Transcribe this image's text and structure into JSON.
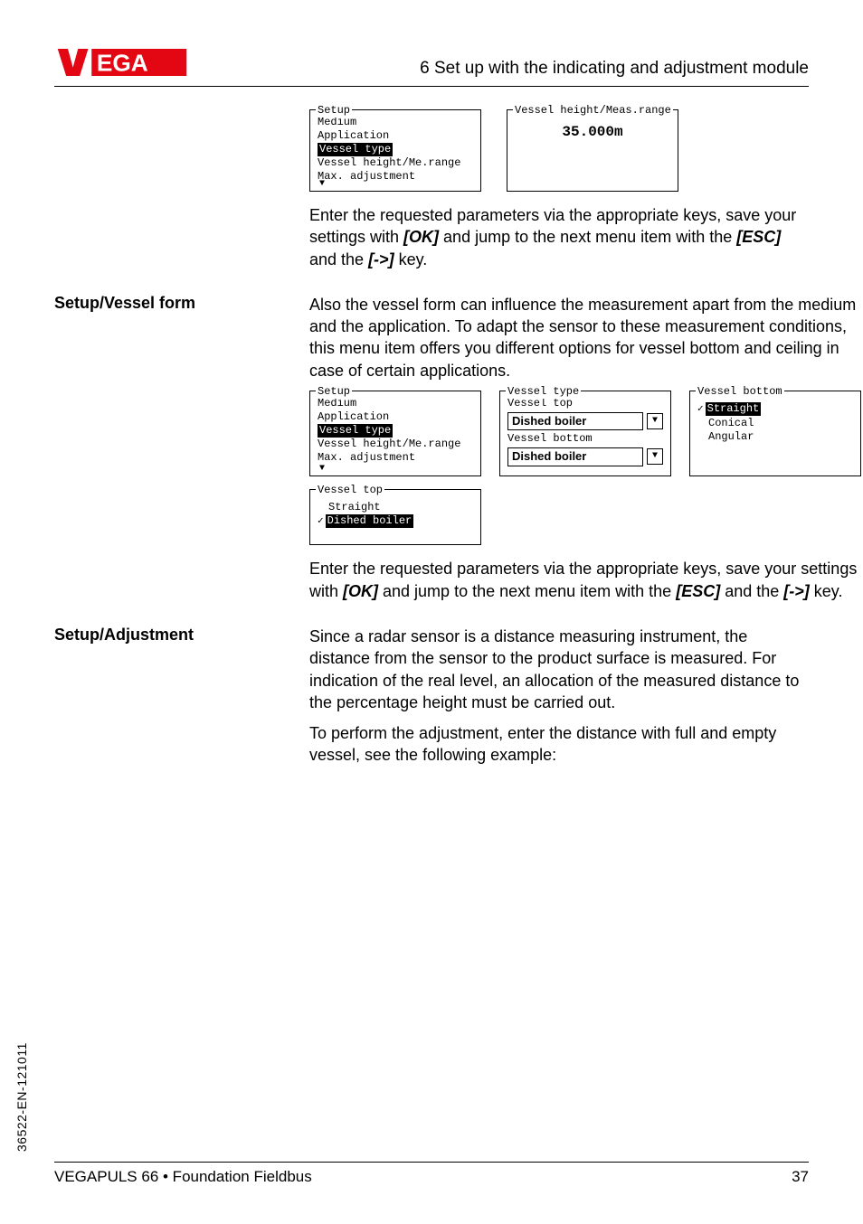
{
  "header": {
    "section_title": "6 Set up with the indicating and adjustment module"
  },
  "intro_lcd": {
    "setup": {
      "title": "Setup",
      "lines": [
        "Medium",
        "Application"
      ],
      "highlight": "Vessel type",
      "lines_after": [
        "Vessel height/Me.range",
        "Max. adjustment"
      ]
    },
    "range": {
      "title": "Vessel height/Meas.range",
      "value": "35.000m"
    }
  },
  "intro_text": {
    "para": "Enter the requested parameters via the appropriate keys, save your settings with ",
    "ok": "[OK]",
    "mid": " and jump to the next menu item with the ",
    "esc": "[ESC]",
    "and": " and the ",
    "arrow": "[->]",
    "tail": " key."
  },
  "vessel_form": {
    "heading": "Setup/Vessel form",
    "para": "Also the vessel form can influence the measurement apart from the medium and the application. To adapt the sensor to these measurement conditions, this menu item offers you different options for vessel bottom and ceiling in case of certain applications.",
    "lcd_setup": {
      "title": "Setup",
      "lines": [
        "Medium",
        "Application"
      ],
      "highlight": "Vessel type",
      "lines_after": [
        "Vessel height/Me.range",
        "Max. adjustment"
      ]
    },
    "lcd_type": {
      "title": "Vessel type",
      "top_label": "Vessel top",
      "top_value": "Dished boiler",
      "bottom_label": "Vessel bottom",
      "bottom_value": "Dished boiler"
    },
    "lcd_bottom": {
      "title": "Vessel bottom",
      "highlight": "Straight",
      "options": [
        "Conical",
        "Angular"
      ]
    },
    "lcd_top": {
      "title": "Vessel top",
      "option1": "Straight",
      "highlight": "Dished boiler"
    },
    "para2_pre": "Enter the requested parameters via the appropriate keys, save your settings with ",
    "ok": "[OK]",
    "mid": " and jump to the next menu item with the ",
    "esc": "[ESC]",
    "and": " and the ",
    "arrow": "[->]",
    "tail": " key."
  },
  "adjustment": {
    "heading": "Setup/Adjustment",
    "para1": "Since a radar sensor is a distance measuring instrument, the distance from the sensor to the product surface is measured. For indication of the real level, an allocation of the measured distance to the percentage height must be carried out.",
    "para2": "To perform the adjustment, enter the distance with full and empty vessel, see the following example:"
  },
  "footer": {
    "left": "VEGAPULS 66 • Foundation Fieldbus",
    "right": "37",
    "side": "36522-EN-121011"
  }
}
